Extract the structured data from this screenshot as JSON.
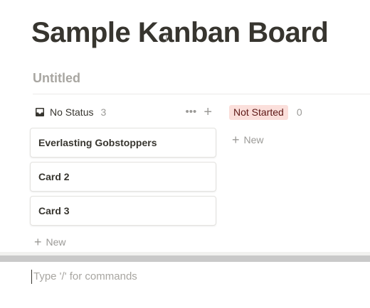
{
  "page": {
    "title": "Sample Kanban Board"
  },
  "view": {
    "title": "Untitled"
  },
  "board": {
    "columns": [
      {
        "label": "No Status",
        "count": "3",
        "cards": [
          "Everlasting Gobstoppers",
          "Card 2",
          "Card 3"
        ],
        "new_label": "New",
        "icon": "inbox-icon"
      },
      {
        "label": "Not Started",
        "count": "0",
        "cards": [],
        "new_label": "New",
        "pill_color": "#fbdfdb",
        "pill_text_color": "#5d1715"
      }
    ]
  },
  "editor": {
    "placeholder": "Type '/' for commands"
  }
}
